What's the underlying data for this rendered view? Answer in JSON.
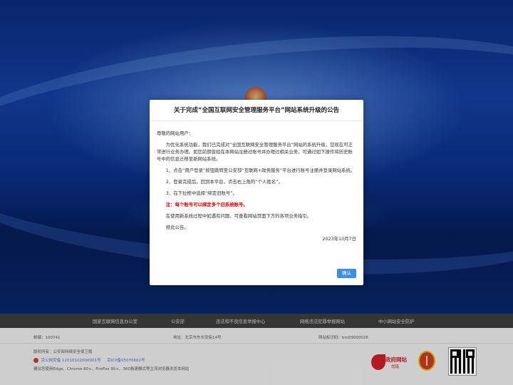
{
  "notice": {
    "title": "关于完成“全国互联网安全管理服务平台”网站系统升级的公告",
    "greeting": "尊敬的网站用户：",
    "para1": "为优化系统功能，我们已完成对“全国互联网安全管理服务平台”网站的系统升级，您现在可正常进行业务办理。如您前期曾经在本网站注册过账号并办理过相关业务，可通过如下操作将历史账号中的信息迁移至新网站系统。",
    "step1": "1、点击“用户登录”按钮跳转至公安部“互联网+政务服务”平台进行账号注册并登录网站系统。",
    "step2": "2、登录完成后，回到本平台，点击右上角的“个人姓名”。",
    "step3": "3、在下拉框中选择“绑定旧账号”。",
    "warning": "注：每个账号可以绑定多个旧系统账号。",
    "para2": "在使用新系统过程中如遇有问题，可查看网站页面下方的各项业务指引。",
    "closing": "特此公告。",
    "date": "2023年10月7日",
    "ok_label": "确认"
  },
  "nav": {
    "items": [
      "国家互联网信息办公室",
      "公安部",
      "违法和不良信息举报中心",
      "网络违法犯罪举报网站",
      "中小网站安全防护"
    ]
  },
  "footer": {
    "postcode": "邮编：100741",
    "address": "地址：北京市东长安街14号",
    "site_id": "网站标识码：bm09000026",
    "copyright": "版权所有：公安部网络安全保卫局",
    "beian1": "京公网安备 11010102000001号",
    "beian2": "京ICP备05070602号",
    "browser_hint": "建议您使用Edge、Chrome 80+、FireFox 90+、360极速模式等主流浏览器浏览本网站",
    "gov_site_label": "政府网站",
    "gov_site_sub": "找错"
  },
  "colors": {
    "accent": "#3a8ee6",
    "warning": "#e00000",
    "nav_bg": "#3c3c3c",
    "footer_bg": "#e6e6e6"
  }
}
